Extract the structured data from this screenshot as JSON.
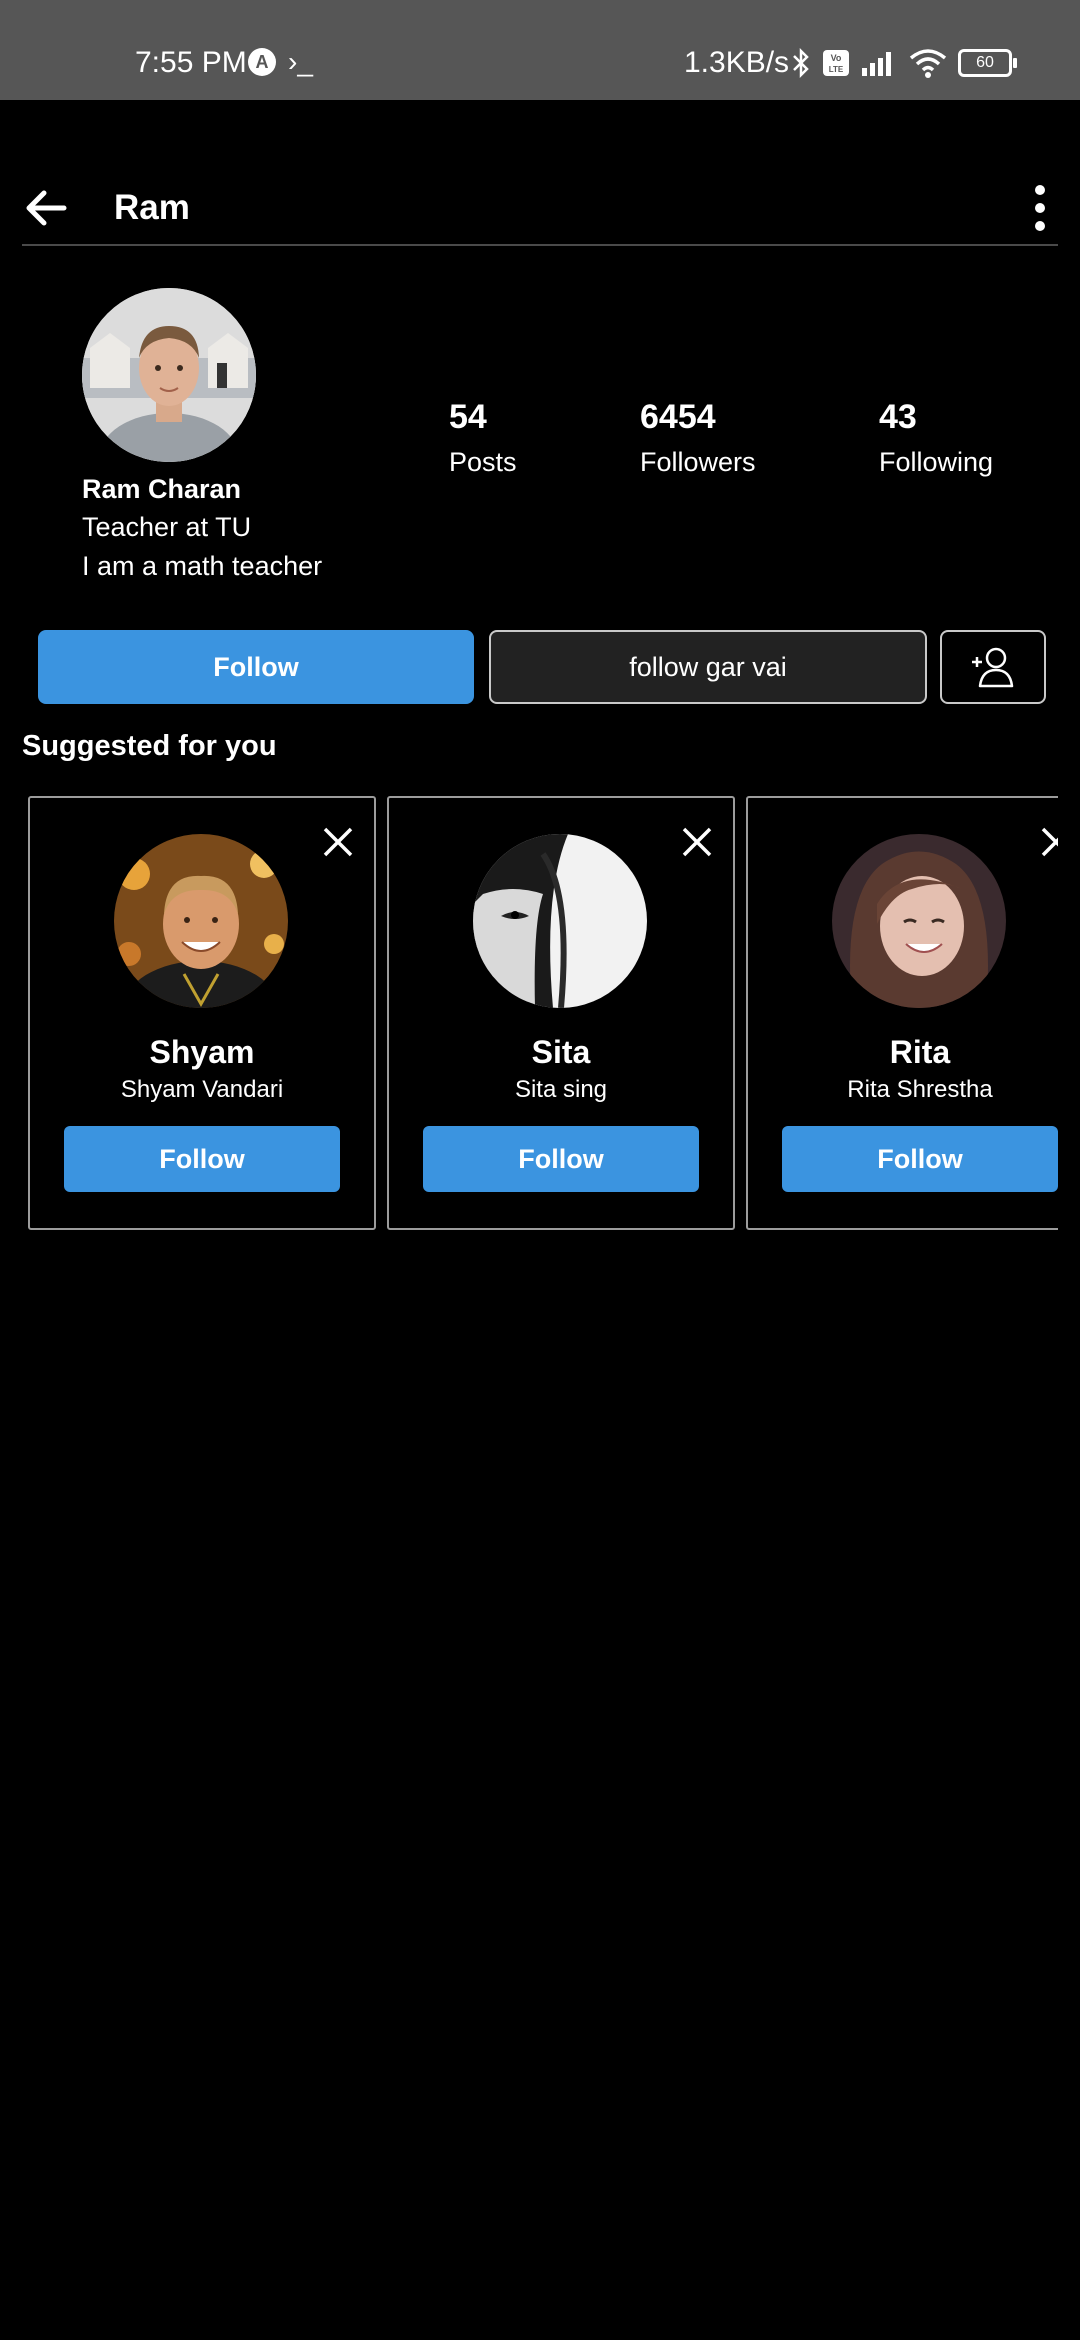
{
  "status_bar": {
    "time": "7:55 PM",
    "app_icon": "A",
    "terminal": "›_",
    "speed": "1.3KB/s",
    "icons": [
      "bluetooth-icon",
      "volte-icon",
      "signal-icon",
      "wifi-icon"
    ],
    "battery": "60"
  },
  "header": {
    "title": "Ram",
    "back_icon": "arrow-left-icon",
    "menu_icon": "more-vertical-icon"
  },
  "profile": {
    "name": "Ram Charan",
    "bio_line1": "Teacher at TU",
    "bio_line2": "I am a math teacher",
    "stats": [
      {
        "value": "54",
        "label": "Posts"
      },
      {
        "value": "6454",
        "label": "Followers"
      },
      {
        "value": "43",
        "label": "Following"
      }
    ]
  },
  "actions": {
    "follow_label": "Follow",
    "secondary_label": "follow gar vai",
    "add_icon": "person-add-icon"
  },
  "suggested": {
    "title": "Suggested for you",
    "cards": [
      {
        "username": "Shyam",
        "fullname": "Shyam Vandari",
        "button": "Follow"
      },
      {
        "username": "Sita",
        "fullname": "Sita sing",
        "button": "Follow"
      },
      {
        "username": "Rita",
        "fullname": "Rita Shrestha",
        "button": "Follow"
      }
    ]
  },
  "colors": {
    "accent": "#3b94e0",
    "background": "#000000",
    "status_bar": "#565656"
  }
}
